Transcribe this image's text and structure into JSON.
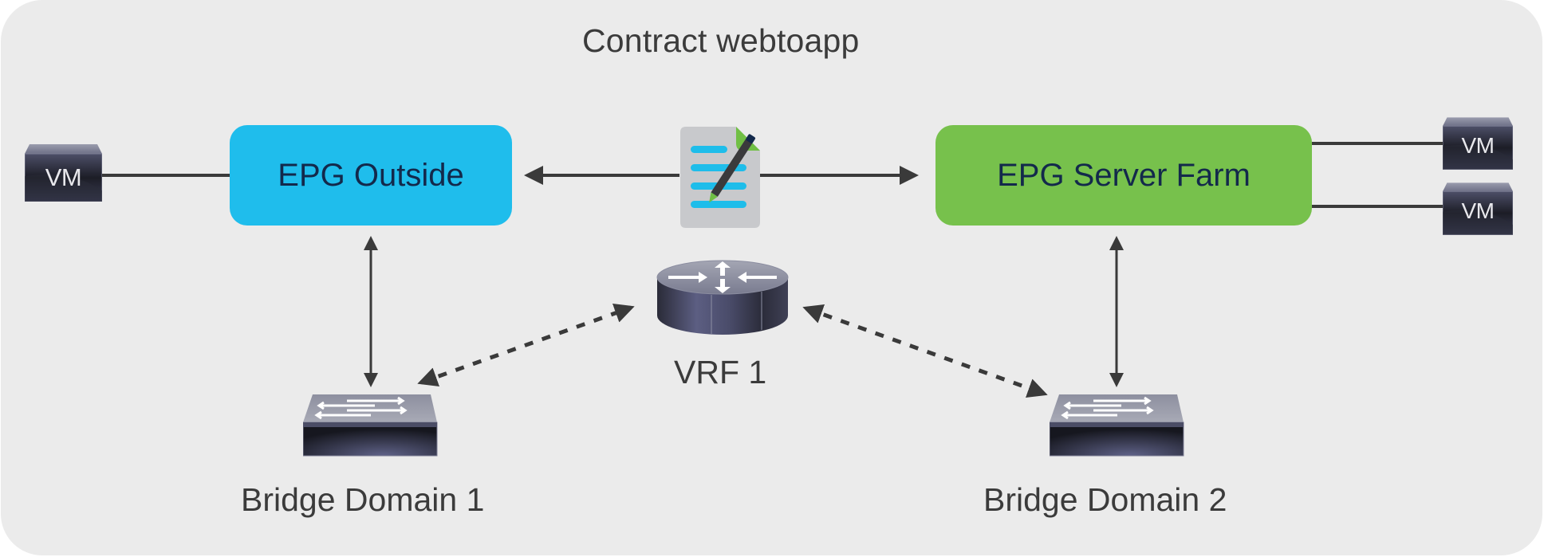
{
  "diagram": {
    "title": "Contract webtoapp",
    "contract_icon": "contract-document-icon",
    "epgs": [
      {
        "id": "epg-outside",
        "label": "EPG Outside",
        "color": "#1fbdec"
      },
      {
        "id": "epg-server-farm",
        "label": "EPG Server Farm",
        "color": "#77c14c"
      }
    ],
    "vms": [
      {
        "label": "VM",
        "attached_to": "EPG Outside"
      },
      {
        "label": "VM",
        "attached_to": "EPG Server Farm"
      },
      {
        "label": "VM",
        "attached_to": "EPG Server Farm"
      }
    ],
    "vrf": {
      "label": "VRF 1",
      "icon": "router-icon"
    },
    "bridge_domains": [
      {
        "label": "Bridge Domain 1",
        "icon": "switch-icon",
        "epg": "EPG Outside"
      },
      {
        "label": "Bridge Domain 2",
        "icon": "switch-icon",
        "epg": "EPG Server Farm"
      }
    ],
    "connections": [
      {
        "from": "VM",
        "to": "EPG Outside",
        "style": "solid-line"
      },
      {
        "from": "Contract webtoapp",
        "to": "EPG Outside",
        "style": "solid-arrow"
      },
      {
        "from": "Contract webtoapp",
        "to": "EPG Server Farm",
        "style": "solid-arrow"
      },
      {
        "from": "EPG Server Farm",
        "to": "VM",
        "style": "solid-line"
      },
      {
        "from": "EPG Server Farm",
        "to": "VM",
        "style": "solid-line"
      },
      {
        "from": "EPG Outside",
        "to": "Bridge Domain 1",
        "style": "solid-double-arrow"
      },
      {
        "from": "EPG Server Farm",
        "to": "Bridge Domain 2",
        "style": "solid-double-arrow"
      },
      {
        "from": "VRF 1",
        "to": "Bridge Domain 1",
        "style": "dashed-double-arrow"
      },
      {
        "from": "VRF 1",
        "to": "Bridge Domain 2",
        "style": "dashed-double-arrow"
      }
    ],
    "colors": {
      "background": "#ebebeb",
      "line": "#3a3a3a",
      "text": "#3b3b3b",
      "epg_text": "#13294b",
      "document_accent": "#1ebdea",
      "document_fold": "#70bf44"
    }
  }
}
